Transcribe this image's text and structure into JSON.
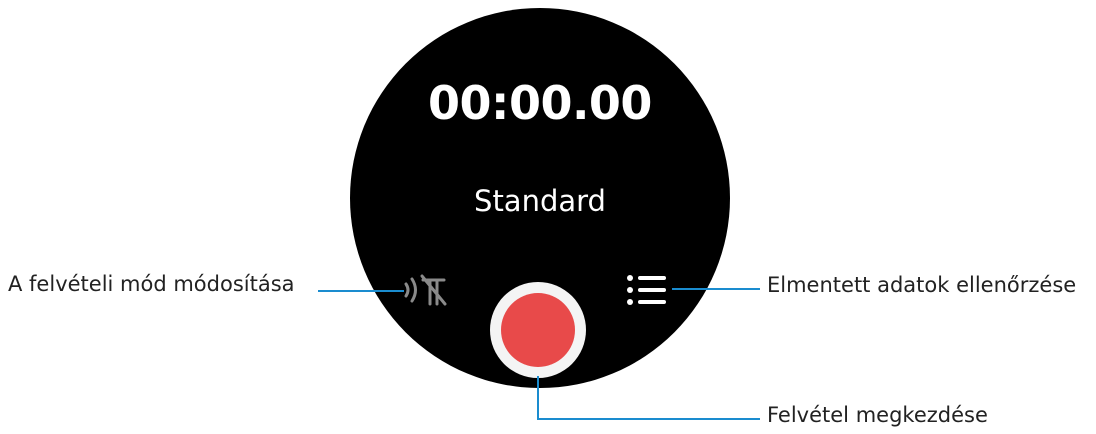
{
  "watch": {
    "timer": "00:00.00",
    "mode": "Standard",
    "mode_icon": "voice-focus-off-icon",
    "list_icon": "list-icon",
    "record_icon": "record-icon"
  },
  "callouts": {
    "change_mode": "A felvételi mód módosítása",
    "saved_data": "Elmentett adatok ellenőrzése",
    "start_recording": "Felvétel megkezdése"
  },
  "colors": {
    "watch_background": "#000000",
    "record_red": "#e84a4a",
    "leader_line": "#1a8ccf",
    "icon_gray": "#8a8a8a"
  }
}
